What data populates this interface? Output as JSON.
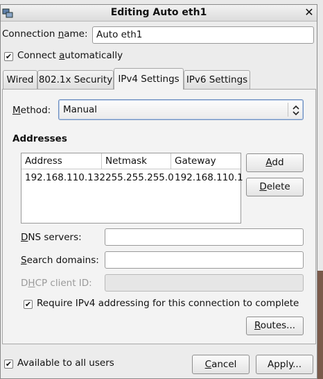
{
  "window": {
    "title": "Editing Auto eth1"
  },
  "connection_name": {
    "label_prefix": "Connection ",
    "label_mnemonic": "n",
    "label_suffix": "ame:",
    "value": "Auto eth1"
  },
  "connect_automatically": {
    "label_prefix": "Connect ",
    "label_mnemonic": "a",
    "label_suffix": "utomatically",
    "checked": true
  },
  "tabs": [
    {
      "label": "Wired"
    },
    {
      "label": "802.1x Security"
    },
    {
      "label": "IPv4 Settings",
      "active": true
    },
    {
      "label": "IPv6 Settings"
    }
  ],
  "method": {
    "label_mnemonic": "M",
    "label_suffix": "ethod:",
    "value": "Manual"
  },
  "addresses": {
    "heading": "Addresses",
    "columns": [
      "Address",
      "Netmask",
      "Gateway"
    ],
    "rows": [
      {
        "address": "192.168.110.132",
        "netmask": "255.255.255.0",
        "gateway": "192.168.110.1"
      }
    ],
    "add_mnemonic": "A",
    "add_suffix": "dd",
    "delete_mnemonic": "D",
    "delete_suffix": "elete"
  },
  "dns_servers": {
    "label_mnemonic": "D",
    "label_suffix": "NS servers:",
    "value": ""
  },
  "search_domains": {
    "label_mnemonic": "S",
    "label_suffix": "earch domains:",
    "value": ""
  },
  "dhcp_client_id": {
    "label_prefix": "D",
    "label_mnemonic": "H",
    "label_suffix": "CP client ID:",
    "value": "",
    "disabled": true
  },
  "require_ipv4": {
    "label": "Require IPv4 addressing for this connection to complete",
    "checked": true
  },
  "routes_button": {
    "label_mnemonic": "R",
    "label_suffix": "outes..."
  },
  "available_all_users": {
    "label": "Available to all users",
    "checked": true
  },
  "cancel_button": {
    "label_mnemonic": "C",
    "label_suffix": "ancel"
  },
  "apply_button": {
    "label": "Apply..."
  },
  "check_glyph": "✔"
}
